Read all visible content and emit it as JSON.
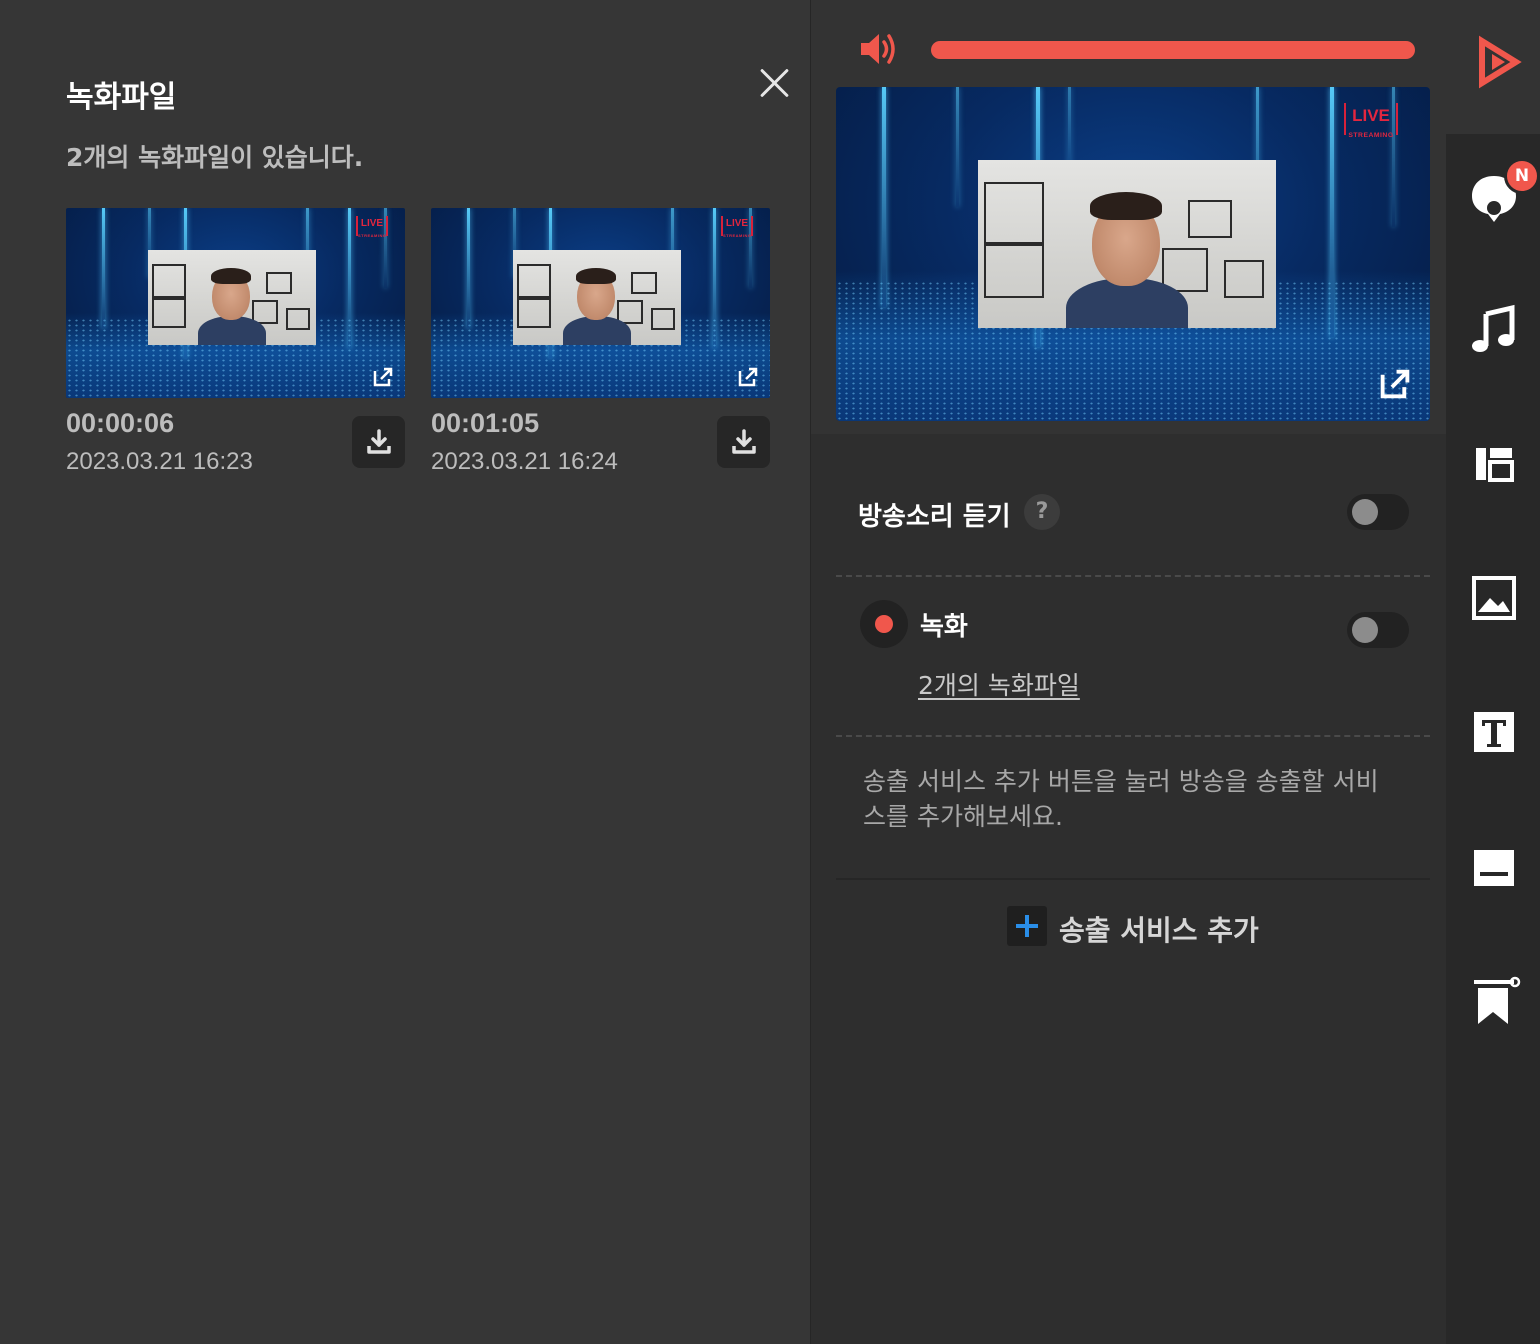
{
  "files_panel": {
    "title": "녹화파일",
    "count_text": "2개의 녹화파일이 있습니다.",
    "files": [
      {
        "duration": "00:00:06",
        "date": "2023.03.21 16:23"
      },
      {
        "duration": "00:01:05",
        "date": "2023.03.21 16:24"
      }
    ]
  },
  "stream_badge": {
    "main": "LIVE",
    "sub": "STREAMING"
  },
  "center_panel": {
    "volume_level": 1.0,
    "listen_label": "방송소리 듣기",
    "help_glyph": "?",
    "listen_enabled": false,
    "record_label": "녹화",
    "record_enabled": false,
    "record_files_link": "2개의 녹화파일",
    "info_text": "송출 서비스 추가 버튼을 눌러 방송을 송출할 서비스를 추가해보세요.",
    "add_service_label": "송출 서비스 추가"
  },
  "toolbar": {
    "items": [
      {
        "icon": "play-icon"
      },
      {
        "icon": "chat-icon",
        "badge": "N"
      },
      {
        "icon": "music-icon"
      },
      {
        "icon": "layout-icon"
      },
      {
        "icon": "image-icon"
      },
      {
        "icon": "text-icon"
      },
      {
        "icon": "subtitle-icon"
      },
      {
        "icon": "bookmark-icon"
      }
    ]
  },
  "colors": {
    "accent": "#f0574c",
    "plus_blue": "#2a8ee8",
    "panel_bg": "#363636",
    "toolbar_bg": "#282828"
  }
}
